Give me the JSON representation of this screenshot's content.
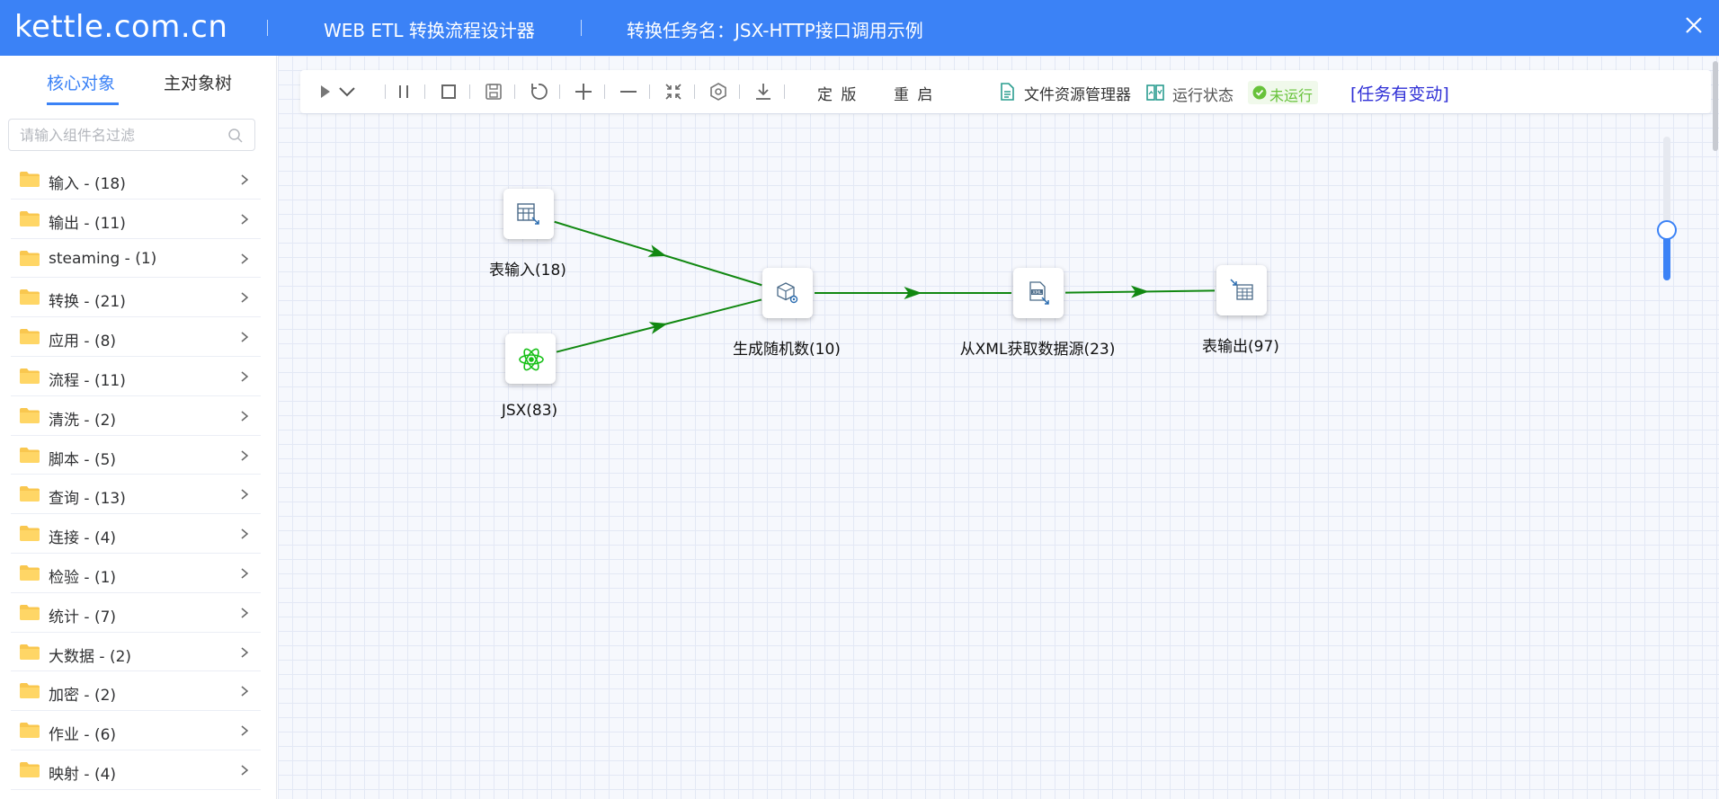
{
  "header": {
    "brand": "kettle.com.cn",
    "designer_title": "WEB ETL 转换流程设计器",
    "task_name": "转换任务名：JSX-HTTP接口调用示例",
    "bg_color": "#3b82f6"
  },
  "sidebar": {
    "tabs": [
      {
        "label": "核心对象",
        "active": true
      },
      {
        "label": "主对象树",
        "active": false
      }
    ],
    "search_placeholder": "请输入组件名过滤",
    "categories": [
      {
        "label": "输入 - (18)"
      },
      {
        "label": "输出 - (11)"
      },
      {
        "label": "steaming - (1)"
      },
      {
        "label": "转换 - (21)"
      },
      {
        "label": "应用 - (8)"
      },
      {
        "label": "流程 - (11)"
      },
      {
        "label": "清洗 - (2)"
      },
      {
        "label": "脚本 - (5)"
      },
      {
        "label": "查询 - (13)"
      },
      {
        "label": "连接 - (4)"
      },
      {
        "label": "检验 - (1)"
      },
      {
        "label": "统计 - (7)"
      },
      {
        "label": "大数据 - (2)"
      },
      {
        "label": "加密 - (2)"
      },
      {
        "label": "作业 - (6)"
      },
      {
        "label": "映射 - (4)"
      }
    ]
  },
  "toolbar": {
    "icons": [
      "play-icon",
      "chevron-down-icon",
      "pause-icon",
      "stop-icon",
      "save-icon",
      "refresh-icon",
      "zoom-in-icon",
      "zoom-out-icon",
      "fit-icon",
      "settings-icon",
      "download-icon"
    ],
    "finalize_label": "定 版",
    "restart_label": "重 启",
    "file_manager_label": "文件资源管理器",
    "run_status_label": "运行状态",
    "run_status_value": "未运行",
    "changed_notice": "[任务有变动]"
  },
  "flow": {
    "nodes": [
      {
        "id": "table-input",
        "label": "表输入(18)",
        "icon": "table-input-icon"
      },
      {
        "id": "jsx",
        "label": "JSX(83)",
        "icon": "react-atom-icon"
      },
      {
        "id": "random",
        "label": "生成随机数(10)",
        "icon": "random-cube-icon"
      },
      {
        "id": "xml",
        "label": "从XML获取数据源(23)",
        "icon": "xml-file-icon"
      },
      {
        "id": "table-output",
        "label": "表输出(97)",
        "icon": "table-output-icon"
      }
    ],
    "edges": [
      {
        "from": "table-input",
        "to": "random"
      },
      {
        "from": "jsx",
        "to": "random"
      },
      {
        "from": "random",
        "to": "xml"
      },
      {
        "from": "xml",
        "to": "table-output"
      }
    ],
    "edge_color": "#118811"
  },
  "zoom": {
    "level": 0.35
  }
}
